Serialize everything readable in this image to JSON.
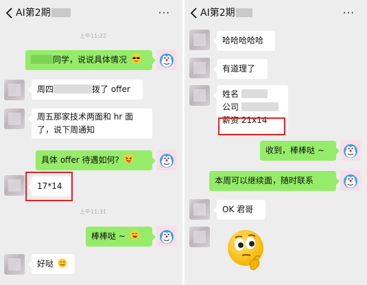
{
  "left_chat": {
    "header": {
      "title": "AI第2期",
      "more_label": "···"
    },
    "timestamps": [
      "上午11:22",
      "上午11:31"
    ],
    "messages": [
      {
        "text": "同学，说说具体情况"
      },
      {
        "text_a": "周四",
        "text_b": "拨了 offer"
      },
      {
        "text": "周五那家技术两面和 hr 面了，说下周通知"
      },
      {
        "text": "具体 offer 待遇如何?"
      },
      {
        "text": "17*14"
      },
      {
        "text": "棒棒哒 ~"
      },
      {
        "text": "好哒"
      }
    ]
  },
  "right_chat": {
    "header": {
      "title": "AI第2期",
      "more_label": "···"
    },
    "messages": [
      {
        "text": "哈哈哈哈哈"
      },
      {
        "text": "有道理了"
      },
      {
        "line1": "姓名",
        "line2": "公司",
        "line3": "薪资  21x14"
      },
      {
        "text": "收到，棒棒哒 ~"
      },
      {
        "text": "本周可以继续面，随时联系"
      },
      {
        "text": "OK 君哥"
      }
    ]
  },
  "colors": {
    "sent_bubble": "#95ec69",
    "received_bubble": "#ffffff",
    "chat_bg": "#ededed",
    "highlight_box": "#e02020"
  },
  "icons": [
    "back-arrow-icon",
    "more-options-icon",
    "sunglasses-emoji-icon",
    "tongue-emoji-icon",
    "grin-emoji-icon",
    "smile-emoji-icon",
    "thinking-emoji-sticker",
    "doraemon-avatar"
  ]
}
